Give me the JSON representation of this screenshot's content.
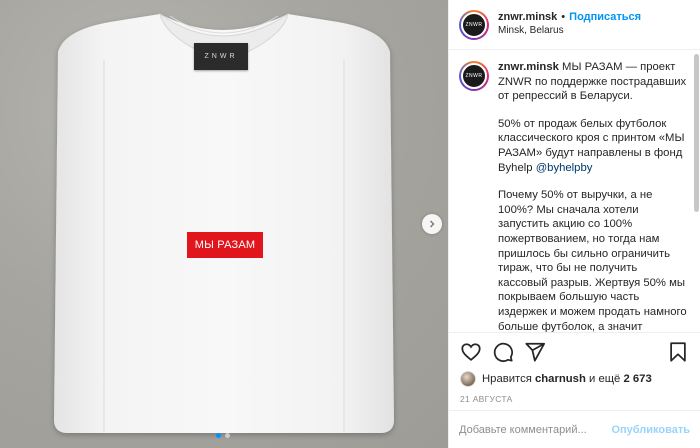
{
  "media": {
    "brand_tag": "ZNWR",
    "print_text": "МЫ РАЗАМ",
    "carousel": {
      "total": 2,
      "active": 1
    }
  },
  "header": {
    "username": "znwr.minsk",
    "separator": "•",
    "follow_label": "Подписаться",
    "location": "Minsk, Belarus",
    "avatar_text": "ZNWR"
  },
  "caption": {
    "username": "znwr.minsk",
    "paragraph1": "МЫ РАЗАМ — проект ZNWR по поддержке пострадавших от репрессий в Беларуси.",
    "paragraph2_text": "50% от продаж белых футболок классического кроя с принтом «МЫ РАЗАМ» будут направлены в фонд Byhelp ",
    "paragraph2_mention": "@byhelpby",
    "paragraph3": "Почему 50% от выручки, а не 100%? Мы сначала хотели запустить акцию со 100% пожертвованием, но тогда нам пришлось бы сильно ограничить тираж, что бы не получить кассовый разрыв. Жертвуя 50% мы покрываем большую часть издержек и можем продать намного больше футболок, а значит суммарно собрать сильно больше денег и помочь большему числу людей."
  },
  "actions": {
    "icons": [
      "heart-icon",
      "comment-icon",
      "share-icon",
      "bookmark-icon"
    ]
  },
  "likes": {
    "prefix": "Нравится",
    "user": "charnush",
    "middle": "и ещё",
    "count": "2 673"
  },
  "date": "21 АВГУСТА",
  "add_comment": {
    "placeholder": "Добавьте комментарий...",
    "publish_label": "Опубликовать"
  },
  "colors": {
    "accent": "#0095f6",
    "print_red": "#e0161c",
    "background_gray": "#a9a8a3"
  }
}
